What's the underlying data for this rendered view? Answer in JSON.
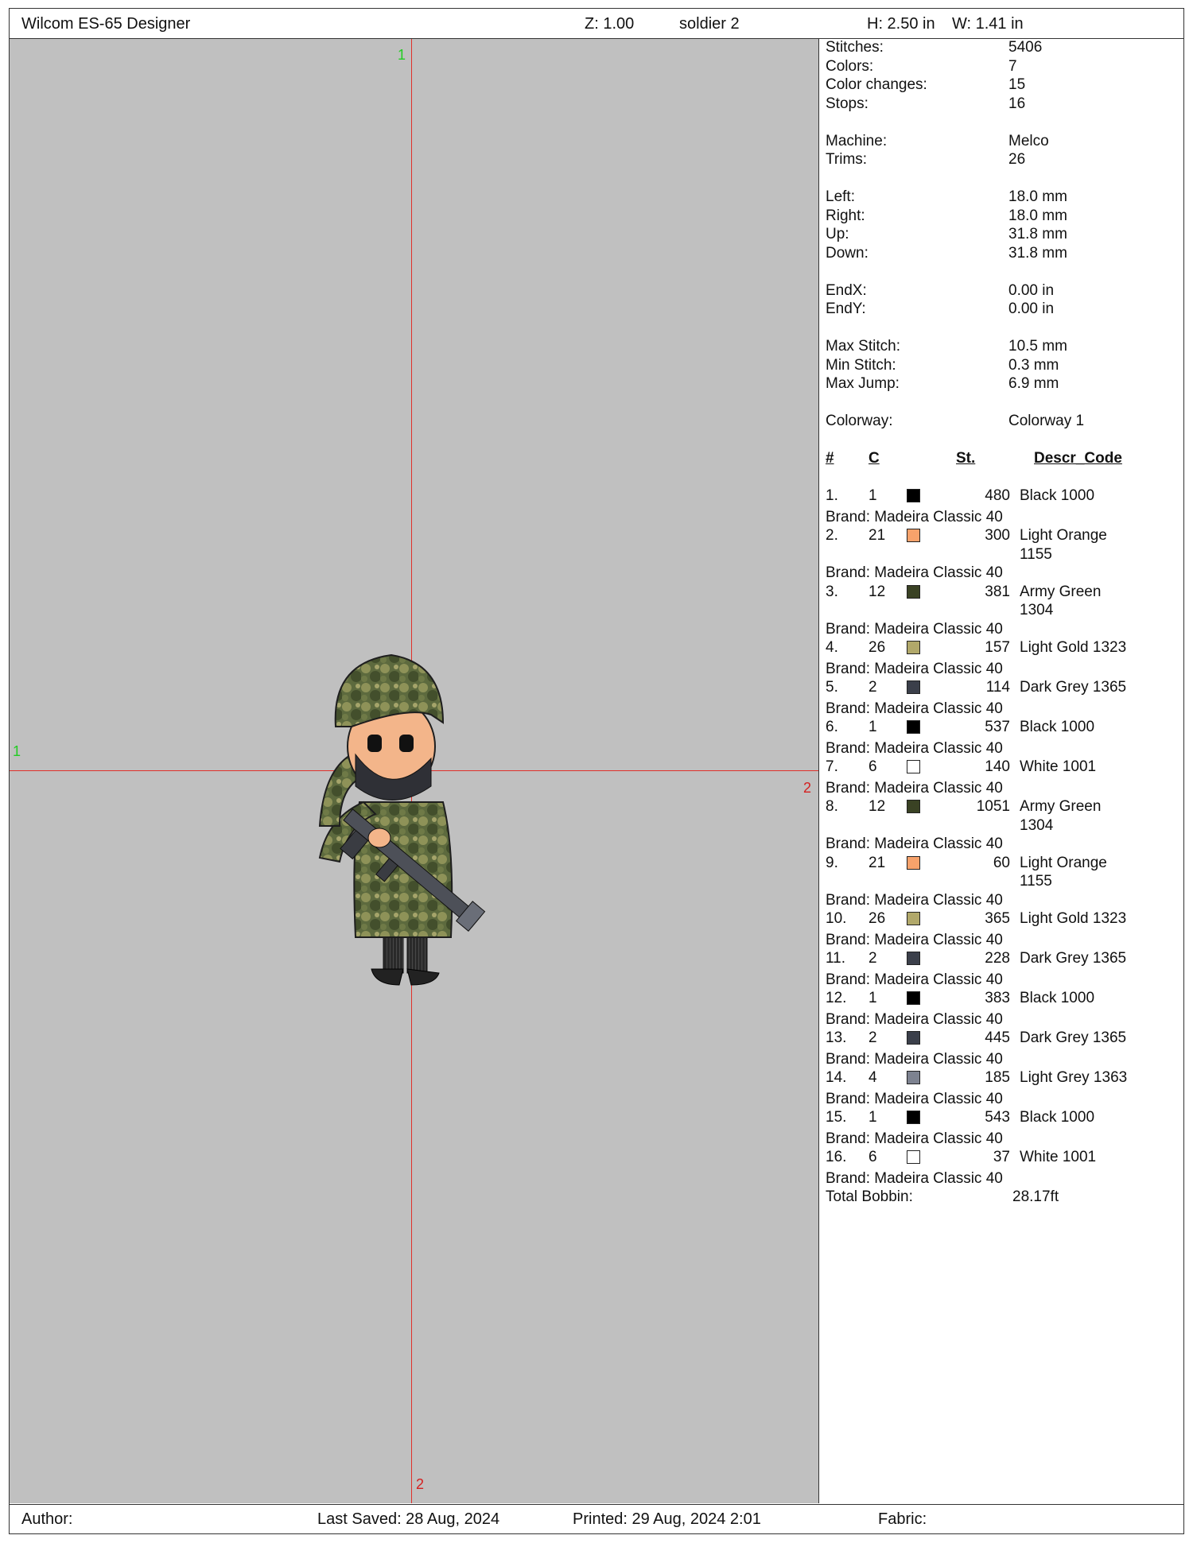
{
  "header": {
    "app_title": "Wilcom ES-65 Designer",
    "zoom": "Z: 1.00",
    "design_name": "soldier 2",
    "height": "H: 2.50 in",
    "width": "W: 1.41 in"
  },
  "canvas": {
    "v_top_label": "1",
    "v_bottom_label": "2",
    "h_left_label": "1",
    "h_right_label": "2"
  },
  "stats": [
    {
      "k": "Stitches:",
      "v": "5406"
    },
    {
      "k": "Colors:",
      "v": "7"
    },
    {
      "k": "Color changes:",
      "v": "15"
    },
    {
      "k": "Stops:",
      "v": "16"
    },
    null,
    {
      "k": "Machine:",
      "v": "Melco"
    },
    {
      "k": "Trims:",
      "v": "26"
    },
    null,
    {
      "k": "Left:",
      "v": "18.0 mm"
    },
    {
      "k": "Right:",
      "v": "18.0 mm"
    },
    {
      "k": "Up:",
      "v": "31.8 mm"
    },
    {
      "k": "Down:",
      "v": "31.8 mm"
    },
    null,
    {
      "k": "EndX:",
      "v": "0.00 in"
    },
    {
      "k": "EndY:",
      "v": "0.00 in"
    },
    null,
    {
      "k": "Max Stitch:",
      "v": "10.5 mm"
    },
    {
      "k": "Min Stitch:",
      "v": "0.3 mm"
    },
    {
      "k": "Max Jump:",
      "v": "6.9 mm"
    },
    null,
    {
      "k": "Colorway:",
      "v": "Colorway 1"
    }
  ],
  "table": {
    "headers": {
      "idx": "#",
      "c": "C",
      "st": "St.",
      "desc": "Descr_Code"
    },
    "rows": [
      {
        "idx": "1.",
        "c": "1",
        "color": "#000000",
        "st": "480",
        "desc": "Black 1000",
        "brand": "Brand: Madeira Classic 40"
      },
      {
        "idx": "2.",
        "c": "21",
        "color": "#f7a26b",
        "st": "300",
        "desc": "Light Orange 1155",
        "brand": "Brand: Madeira Classic 40"
      },
      {
        "idx": "3.",
        "c": "12",
        "color": "#3a4224",
        "st": "381",
        "desc": "Army Green 1304",
        "brand": "Brand: Madeira Classic 40"
      },
      {
        "idx": "4.",
        "c": "26",
        "color": "#b1a86a",
        "st": "157",
        "desc": "Light Gold 1323",
        "brand": "Brand: Madeira Classic 40"
      },
      {
        "idx": "5.",
        "c": "2",
        "color": "#3b3f4a",
        "st": "114",
        "desc": "Dark Grey 1365",
        "brand": "Brand: Madeira Classic 40"
      },
      {
        "idx": "6.",
        "c": "1",
        "color": "#000000",
        "st": "537",
        "desc": "Black 1000",
        "brand": "Brand: Madeira Classic 40"
      },
      {
        "idx": "7.",
        "c": "6",
        "color": "#ffffff",
        "st": "140",
        "desc": "White 1001",
        "brand": "Brand: Madeira Classic 40"
      },
      {
        "idx": "8.",
        "c": "12",
        "color": "#3a4224",
        "st": "1051",
        "desc": "Army Green 1304",
        "brand": "Brand: Madeira Classic 40"
      },
      {
        "idx": "9.",
        "c": "21",
        "color": "#f7a26b",
        "st": "60",
        "desc": "Light Orange 1155",
        "brand": "Brand: Madeira Classic 40"
      },
      {
        "idx": "10.",
        "c": "26",
        "color": "#b1a86a",
        "st": "365",
        "desc": "Light Gold 1323",
        "brand": "Brand: Madeira Classic 40"
      },
      {
        "idx": "11.",
        "c": "2",
        "color": "#3b3f4a",
        "st": "228",
        "desc": "Dark Grey 1365",
        "brand": "Brand: Madeira Classic 40"
      },
      {
        "idx": "12.",
        "c": "1",
        "color": "#000000",
        "st": "383",
        "desc": "Black 1000",
        "brand": "Brand: Madeira Classic 40"
      },
      {
        "idx": "13.",
        "c": "2",
        "color": "#3b3f4a",
        "st": "445",
        "desc": "Dark Grey 1365",
        "brand": "Brand: Madeira Classic 40"
      },
      {
        "idx": "14.",
        "c": "4",
        "color": "#7d8290",
        "st": "185",
        "desc": "Light Grey 1363",
        "brand": "Brand: Madeira Classic 40"
      },
      {
        "idx": "15.",
        "c": "1",
        "color": "#000000",
        "st": "543",
        "desc": "Black 1000",
        "brand": "Brand: Madeira Classic 40"
      },
      {
        "idx": "16.",
        "c": "6",
        "color": "#ffffff",
        "st": "37",
        "desc": "White 1001",
        "brand": "Brand: Madeira Classic 40"
      }
    ],
    "total_label": "Total Bobbin:",
    "total_value": "28.17ft"
  },
  "footer": {
    "author": "Author:",
    "last_saved": "Last Saved: 28 Aug, 2024",
    "printed": "Printed: 29 Aug, 2024  2:01",
    "fabric": "Fabric:"
  }
}
